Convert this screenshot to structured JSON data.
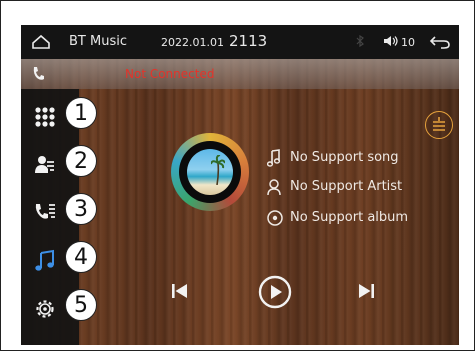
{
  "header": {
    "title": "BT Music",
    "date": "2022.01.01",
    "time": "2113",
    "volume": "10"
  },
  "status": {
    "connection": "Not Connected"
  },
  "sidebar": {
    "items": [
      {
        "number": "1",
        "icon": "apps-grid-icon"
      },
      {
        "number": "2",
        "icon": "contacts-icon"
      },
      {
        "number": "3",
        "icon": "call-log-icon"
      },
      {
        "number": "4",
        "icon": "music-note-icon"
      },
      {
        "number": "5",
        "icon": "settings-gear-icon"
      }
    ]
  },
  "track": {
    "song": "No Support song",
    "artist": "No Support Artist",
    "album": "No Support album"
  },
  "colors": {
    "topbar": "#141414",
    "sidebar": "#141414",
    "alert_text": "#e4332a",
    "active_icon": "#3d8fe6",
    "equalizer": "#e6a23c"
  }
}
